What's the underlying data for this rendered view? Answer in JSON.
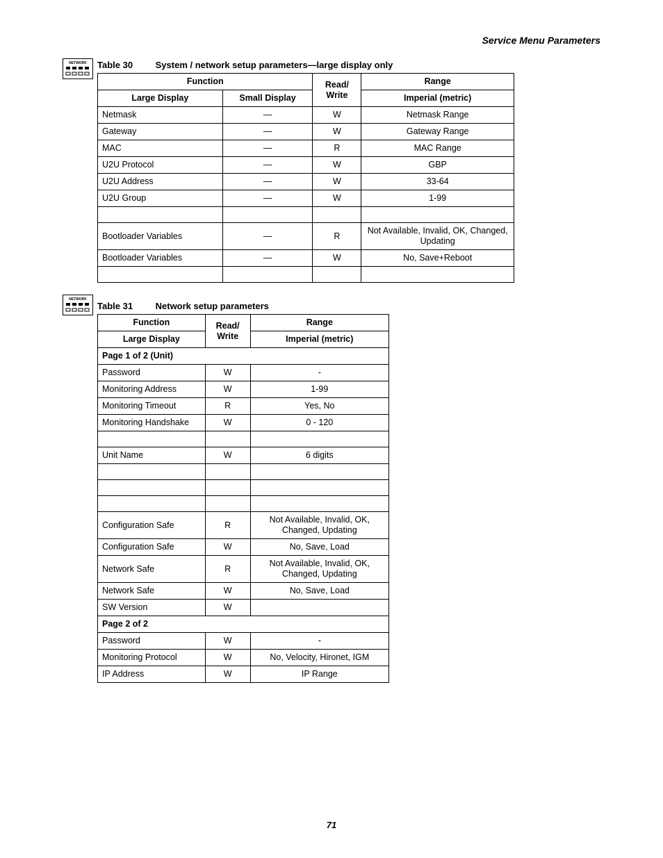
{
  "header": {
    "section_title": "Service Menu Parameters"
  },
  "page_number": "71",
  "icon_label": "NETWORK",
  "table30": {
    "caption_num": "Table 30",
    "caption_text": "System / network setup parameters—large display only",
    "headers": {
      "function": "Function",
      "large_display": "Large Display",
      "small_display": "Small Display",
      "read_write": "Read/ Write",
      "range": "Range",
      "imperial_metric": "Imperial (metric)"
    },
    "rows": [
      {
        "ld": "Netmask",
        "sd": "—",
        "rw": "W",
        "range": "Netmask Range"
      },
      {
        "ld": "Gateway",
        "sd": "—",
        "rw": "W",
        "range": "Gateway Range"
      },
      {
        "ld": "MAC",
        "sd": "—",
        "rw": "R",
        "range": "MAC Range"
      },
      {
        "ld": "U2U Protocol",
        "sd": "—",
        "rw": "W",
        "range": "GBP"
      },
      {
        "ld": "U2U Address",
        "sd": "—",
        "rw": "W",
        "range": "33-64"
      },
      {
        "ld": "U2U Group",
        "sd": "—",
        "rw": "W",
        "range": "1-99"
      },
      {
        "ld": "",
        "sd": "",
        "rw": "",
        "range": ""
      },
      {
        "ld": "Bootloader Variables",
        "sd": "—",
        "rw": "R",
        "range": "Not Available, Invalid, OK, Changed, Updating"
      },
      {
        "ld": "Bootloader Variables",
        "sd": "—",
        "rw": "W",
        "range": "No, Save+Reboot"
      },
      {
        "ld": "",
        "sd": "",
        "rw": "",
        "range": ""
      }
    ]
  },
  "table31": {
    "caption_num": "Table 31",
    "caption_text": "Network setup parameters",
    "headers": {
      "function": "Function",
      "large_display": "Large Display",
      "read_write": "Read/ Write",
      "range": "Range",
      "imperial_metric": "Imperial (metric)"
    },
    "rows": [
      {
        "type": "sub",
        "text": "Page 1 of 2 (Unit)"
      },
      {
        "ld": "Password",
        "rw": "W",
        "range": "-"
      },
      {
        "ld": "Monitoring Address",
        "rw": "W",
        "range": "1-99"
      },
      {
        "ld": "Monitoring Timeout",
        "rw": "R",
        "range": "Yes, No"
      },
      {
        "ld": "Monitoring Handshake",
        "rw": "W",
        "range": "0 - 120"
      },
      {
        "ld": "",
        "rw": "",
        "range": ""
      },
      {
        "ld": "Unit Name",
        "rw": "W",
        "range": "6 digits"
      },
      {
        "ld": "",
        "rw": "",
        "range": ""
      },
      {
        "ld": "",
        "rw": "",
        "range": ""
      },
      {
        "ld": "",
        "rw": "",
        "range": ""
      },
      {
        "ld": "Configuration Safe",
        "rw": "R",
        "range": "Not Available, Invalid, OK, Changed, Updating"
      },
      {
        "ld": "Configuration Safe",
        "rw": "W",
        "range": "No, Save, Load"
      },
      {
        "ld": "Network Safe",
        "rw": "R",
        "range": "Not Available, Invalid, OK, Changed, Updating"
      },
      {
        "ld": "Network Safe",
        "rw": "W",
        "range": "No, Save, Load"
      },
      {
        "ld": "SW Version",
        "rw": "W",
        "range": ""
      },
      {
        "type": "sub",
        "text": "Page 2 of 2"
      },
      {
        "ld": "Password",
        "rw": "W",
        "range": "-"
      },
      {
        "ld": "Monitoring Protocol",
        "rw": "W",
        "range": "No, Velocity, Hironet, IGM"
      },
      {
        "ld": "IP Address",
        "rw": "W",
        "range": "IP Range"
      }
    ]
  }
}
